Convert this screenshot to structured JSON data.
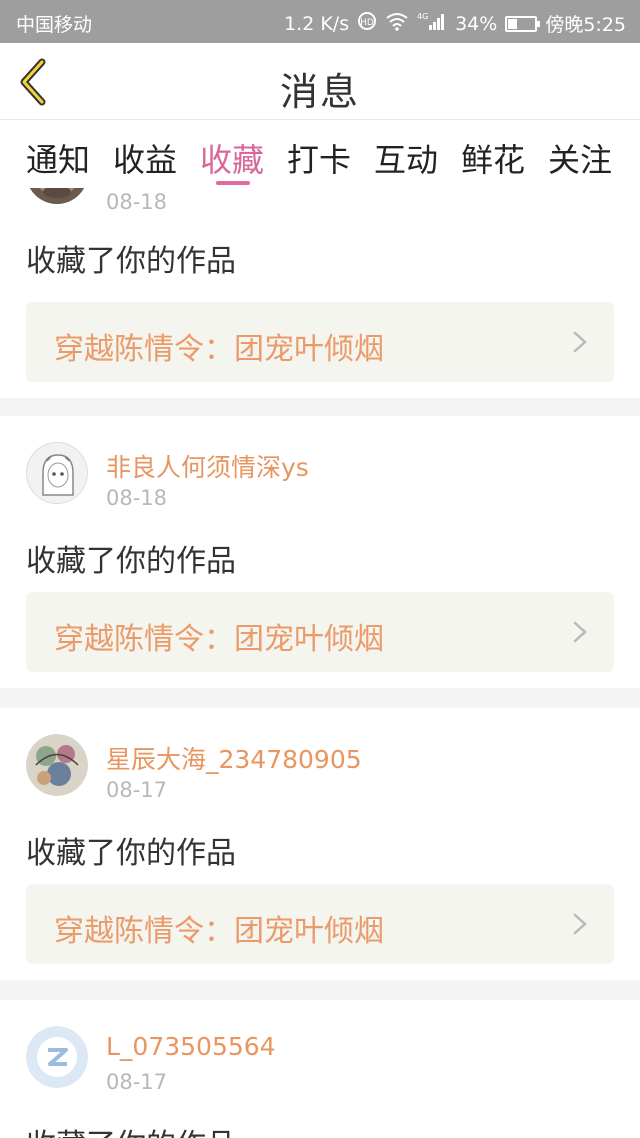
{
  "status_bar": {
    "carrier": "中国移动",
    "speed": "1.2 K/s",
    "network": "4G",
    "battery": "34%",
    "battery_level": 0.34,
    "time": "傍晚5:25"
  },
  "header": {
    "title": "消息"
  },
  "tabs": [
    {
      "label": "通知",
      "active": false
    },
    {
      "label": "收益",
      "active": false
    },
    {
      "label": "收藏",
      "active": true
    },
    {
      "label": "打卡",
      "active": false
    },
    {
      "label": "互动",
      "active": false
    },
    {
      "label": "鲜花",
      "active": false
    },
    {
      "label": "关注",
      "active": false
    }
  ],
  "messages": [
    {
      "user": "",
      "date": "08-18",
      "action": "收藏了你的作品",
      "work_title": "穿越陈情令：团宠叶倾烟",
      "avatar_icon": "face-avatar"
    },
    {
      "user": "非良人何须情深ys",
      "date": "08-18",
      "action": "收藏了你的作品",
      "work_title": "穿越陈情令：团宠叶倾烟",
      "avatar_icon": "anime-girl-avatar"
    },
    {
      "user": "星辰大海_234780905",
      "date": "08-17",
      "action": "收藏了你的作品",
      "work_title": "穿越陈情令：团宠叶倾烟",
      "avatar_icon": "floral-avatar"
    },
    {
      "user": "L_073505564",
      "date": "08-17",
      "action": "收藏了你的作品",
      "work_title": "",
      "avatar_icon": "default-avatar"
    }
  ],
  "colors": {
    "accent": "#e36aa0",
    "username": "#e8955f",
    "work_title": "#eb9a6a",
    "status_bar": "#9e9e9e"
  }
}
